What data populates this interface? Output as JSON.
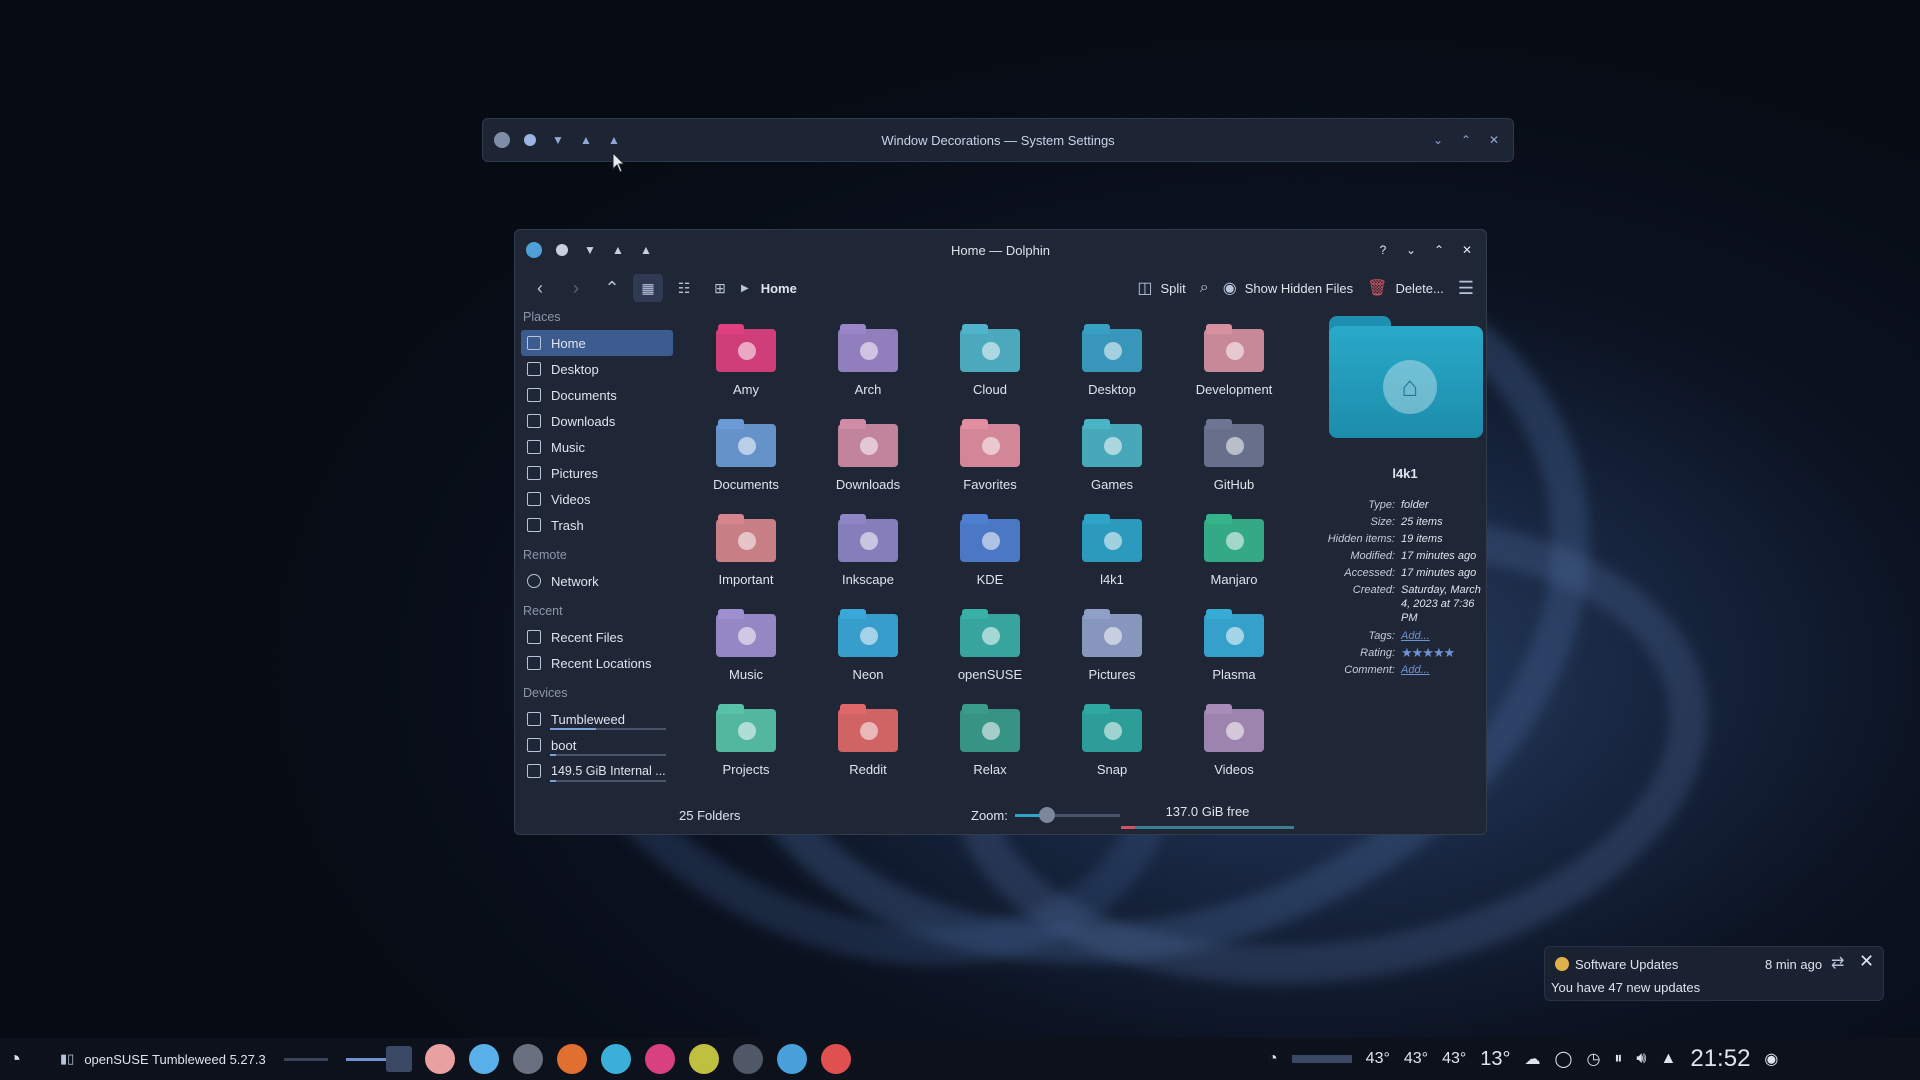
{
  "settings_window": {
    "title": "Window Decorations — System Settings"
  },
  "dolphin": {
    "title": "Home — Dolphin",
    "toolbar": {
      "breadcrumb": "Home",
      "split": "Split",
      "show_hidden": "Show Hidden Files",
      "delete": "Delete..."
    },
    "sidebar": {
      "places_label": "Places",
      "places": [
        "Home",
        "Desktop",
        "Documents",
        "Downloads",
        "Music",
        "Pictures",
        "Videos",
        "Trash"
      ],
      "remote_label": "Remote",
      "remote": [
        "Network"
      ],
      "recent_label": "Recent",
      "recent": [
        "Recent Files",
        "Recent Locations"
      ],
      "devices_label": "Devices",
      "devices": [
        {
          "label": "Tumbleweed",
          "usage": 0.4
        },
        {
          "label": "boot",
          "usage": 0.05
        },
        {
          "label": "149.5 GiB Internal ...",
          "usage": 0.05
        }
      ]
    },
    "folders": [
      {
        "name": "Amy",
        "color": "#e04080"
      },
      {
        "name": "Arch",
        "color": "#9a86c9"
      },
      {
        "name": "Cloud",
        "color": "#4fb3c9"
      },
      {
        "name": "Desktop",
        "color": "#3aa0c4"
      },
      {
        "name": "Development",
        "color": "#d690a0"
      },
      {
        "name": "Documents",
        "color": "#6a9bd6"
      },
      {
        "name": "Downloads",
        "color": "#d08ca6"
      },
      {
        "name": "Favorites",
        "color": "#e28ea0"
      },
      {
        "name": "Games",
        "color": "#4ab3c4"
      },
      {
        "name": "GitHub",
        "color": "#6e7592"
      },
      {
        "name": "Important",
        "color": "#d6858c"
      },
      {
        "name": "Inkscape",
        "color": "#8f86c6"
      },
      {
        "name": "KDE",
        "color": "#4f7fd0"
      },
      {
        "name": "l4k1",
        "color": "#2ea4c8"
      },
      {
        "name": "Manjaro",
        "color": "#35b48c"
      },
      {
        "name": "Music",
        "color": "#9e8fd0"
      },
      {
        "name": "Neon",
        "color": "#3aa8d8"
      },
      {
        "name": "openSUSE",
        "color": "#39b0a6"
      },
      {
        "name": "Pictures",
        "color": "#8fa0c8"
      },
      {
        "name": "Plasma",
        "color": "#37aad6"
      },
      {
        "name": "Projects",
        "color": "#58c2a8"
      },
      {
        "name": "Reddit",
        "color": "#e06868"
      },
      {
        "name": "Relax",
        "color": "#3a9c8a"
      },
      {
        "name": "Snap",
        "color": "#2fa8a0"
      },
      {
        "name": "Videos",
        "color": "#a88cb8"
      }
    ],
    "info": {
      "name": "l4k1",
      "type_k": "Type:",
      "type_v": "folder",
      "size_k": "Size:",
      "size_v": "25 items",
      "hidden_k": "Hidden items:",
      "hidden_v": "19 items",
      "modified_k": "Modified:",
      "modified_v": "17 minutes ago",
      "accessed_k": "Accessed:",
      "accessed_v": "17 minutes ago",
      "created_k": "Created:",
      "created_v": "Saturday, March 4, 2023 at 7:36 PM",
      "tags_k": "Tags:",
      "tags_v": "Add...",
      "rating_k": "Rating:",
      "rating_v": "★★★★★",
      "rating_stars": 5,
      "comment_k": "Comment:",
      "comment_v": "Add..."
    },
    "status": {
      "folders": "25 Folders",
      "zoom_label": "Zoom:",
      "zoom_level": 0.3,
      "free": "137.0 GiB free",
      "used_fraction": 0.08
    }
  },
  "notification": {
    "title": "Software Updates",
    "time": "8 min ago",
    "body": "You have 47 new updates"
  },
  "taskbar": {
    "distro": "openSUSE Tumbleweed 5.27.3",
    "temps": [
      "43°",
      "43°",
      "43°"
    ],
    "weather": "13°",
    "clock": "21:52",
    "apps": [
      "#e8a0a0",
      "#5ab0e8",
      "#6a7080",
      "#e07030",
      "#3ab0d8",
      "#d84080",
      "#c0c040",
      "#505868",
      "#4aa0d8",
      "#e05050"
    ]
  }
}
